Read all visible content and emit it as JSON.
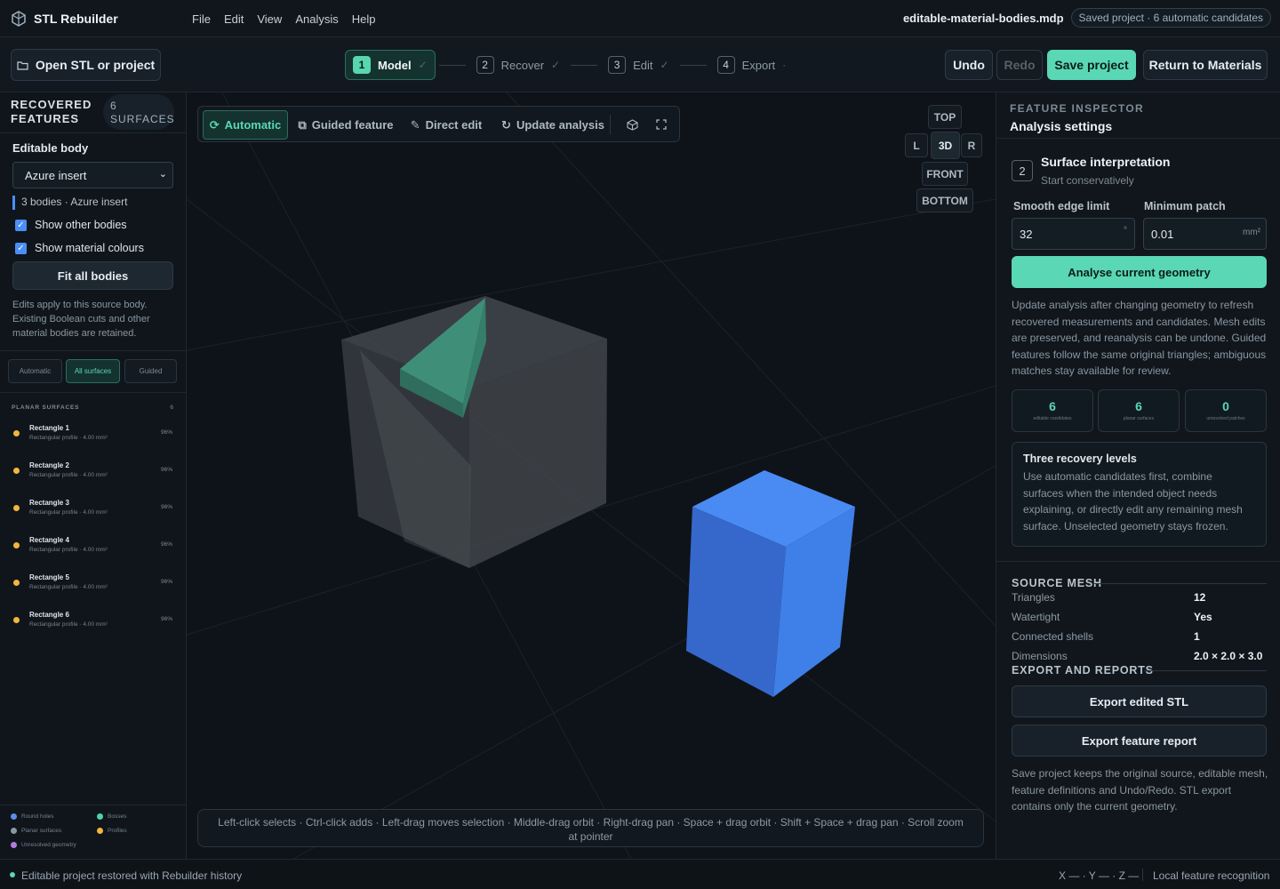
{
  "app": {
    "name": "STL Rebuilder",
    "menus": [
      "File",
      "Edit",
      "View",
      "Analysis",
      "Help"
    ],
    "file_name": "editable-material-bodies.mdp",
    "status_badge": "Saved project · 6 automatic candidates"
  },
  "toolbar": {
    "open_label": "Open STL or project",
    "steps": [
      {
        "num": "1",
        "label": "Model",
        "check": "✓"
      },
      {
        "num": "2",
        "label": "Recover",
        "check": "✓"
      },
      {
        "num": "3",
        "label": "Edit",
        "check": "✓"
      },
      {
        "num": "4",
        "label": "Export",
        "check": "·"
      }
    ],
    "undo": "Undo",
    "redo": "Redo",
    "save": "Save project",
    "return": "Return to Materials"
  },
  "left": {
    "title_line1": "RECOVERED",
    "title_line2": "FEATURES",
    "count_badge_line1": "6",
    "count_badge_line2": "SURFACES",
    "body_label": "Editable body",
    "body_select": "Azure insert",
    "body_info": "3 bodies · Azure insert",
    "show_other": "Show other bodies",
    "show_colours": "Show material colours",
    "fit_button": "Fit all bodies",
    "note": "Edits apply to this source body. Existing Boolean cuts and other material bodies are retained.",
    "filters": [
      "Automatic",
      "All surfaces",
      "Guided"
    ],
    "section_title": "PLANAR SURFACES",
    "section_count": "6",
    "surfaces": [
      {
        "name": "Rectangle 1",
        "sub": "Rectangular profile · 4.00 mm²",
        "pct": "96%"
      },
      {
        "name": "Rectangle 2",
        "sub": "Rectangular profile · 4.00 mm²",
        "pct": "96%"
      },
      {
        "name": "Rectangle 3",
        "sub": "Rectangular profile · 4.00 mm²",
        "pct": "96%"
      },
      {
        "name": "Rectangle 4",
        "sub": "Rectangular profile · 4.00 mm²",
        "pct": "96%"
      },
      {
        "name": "Rectangle 5",
        "sub": "Rectangular profile · 4.00 mm²",
        "pct": "96%"
      },
      {
        "name": "Rectangle 6",
        "sub": "Rectangular profile · 4.00 mm²",
        "pct": "96%"
      }
    ],
    "legend": [
      "Round holes",
      "Bosses",
      "Planar surfaces",
      "Profiles",
      "Unresolved geometry"
    ]
  },
  "viewport": {
    "modes": [
      "Automatic",
      "Guided feature",
      "Direct edit",
      "Update analysis"
    ],
    "views": {
      "top": "TOP",
      "left": "L",
      "iso": "3D",
      "right": "R",
      "front": "FRONT",
      "bottom": "BOTTOM"
    },
    "hint": "Left-click selects · Ctrl-click adds · Left-drag moves selection · Middle-drag orbit · Right-drag pan · Space + drag orbit · Shift + Space + drag pan · Scroll zoom at pointer"
  },
  "inspector": {
    "kicker": "FEATURE INSPECTOR",
    "title": "Analysis settings",
    "step_num": "2",
    "step_title": "Surface interpretation",
    "step_sub": "Start conservatively",
    "smooth_label": "Smooth edge limit",
    "smooth_value": "32",
    "smooth_unit": "°",
    "patch_label": "Minimum patch",
    "patch_value": "0.01",
    "patch_unit": "mm²",
    "analyse_button": "Analyse current geometry",
    "desc": "Update analysis after changing geometry to refresh recovered measurements and candidates. Mesh edits are preserved, and reanalysis can be undone. Guided features follow the same original triangles; ambiguous matches stay available for review.",
    "stats": [
      {
        "n": "6",
        "l": "editable candidates"
      },
      {
        "n": "6",
        "l": "planar surfaces"
      },
      {
        "n": "0",
        "l": "unresolved patches"
      }
    ],
    "levels_title": "Three recovery levels",
    "levels_text": "Use automatic candidates first, combine surfaces when the intended object needs explaining, or directly edit any remaining mesh surface. Unselected geometry stays frozen.",
    "source_title": "SOURCE MESH",
    "source": [
      {
        "k": "Triangles",
        "v": "12"
      },
      {
        "k": "Watertight",
        "v": "Yes"
      },
      {
        "k": "Connected shells",
        "v": "1"
      },
      {
        "k": "Dimensions",
        "v": "2.0 × 2.0 × 3.0"
      }
    ],
    "export_title": "EXPORT AND REPORTS",
    "export_stl": "Export edited STL",
    "export_report": "Export feature report",
    "export_note": "Save project keeps the original source, editable mesh, feature definitions and Undo/Redo. STL export contains only the current geometry."
  },
  "statusbar": {
    "message": "Editable project restored with Rebuilder history",
    "axes": "X — · Y — · Z —",
    "mode": "Local feature recognition"
  },
  "colors": {
    "accent": "#57d6b0",
    "blue_body": "#3f7fe8",
    "surface_dot": "#f3b63b"
  }
}
